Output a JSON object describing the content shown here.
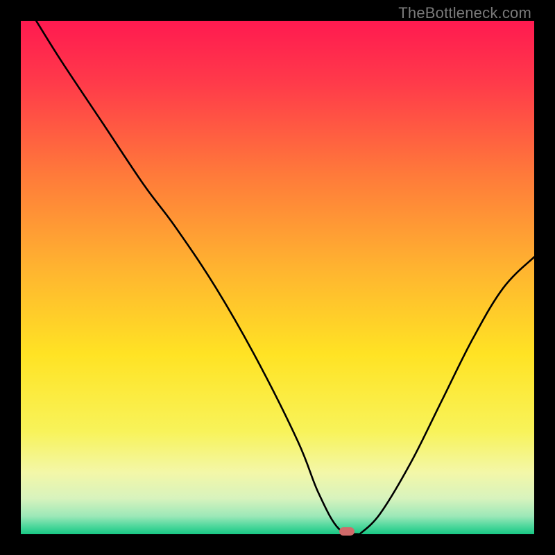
{
  "attribution": "TheBottleneck.com",
  "marker": {
    "x_pct": 63.5,
    "y_pct": 99.5,
    "color": "#d06a6a"
  },
  "chart_data": {
    "type": "line",
    "title": "",
    "xlabel": "",
    "ylabel": "",
    "xlim": [
      0,
      100
    ],
    "ylim": [
      0,
      100
    ],
    "background_gradient": {
      "direction": "vertical",
      "stops": [
        {
          "pos": 0.0,
          "color": "#ff1a50"
        },
        {
          "pos": 0.12,
          "color": "#ff3a4a"
        },
        {
          "pos": 0.3,
          "color": "#ff7a3a"
        },
        {
          "pos": 0.48,
          "color": "#ffb330"
        },
        {
          "pos": 0.65,
          "color": "#ffe324"
        },
        {
          "pos": 0.8,
          "color": "#f8f35a"
        },
        {
          "pos": 0.88,
          "color": "#f3f7a8"
        },
        {
          "pos": 0.93,
          "color": "#d8f3bd"
        },
        {
          "pos": 0.965,
          "color": "#9ce8b8"
        },
        {
          "pos": 0.985,
          "color": "#4cd79b"
        },
        {
          "pos": 1.0,
          "color": "#18c884"
        }
      ]
    },
    "series": [
      {
        "name": "left-segment",
        "x": [
          3,
          8,
          16,
          24,
          30,
          38,
          46,
          54,
          58,
          62,
          66
        ],
        "y": [
          100,
          92,
          80,
          68,
          60,
          48,
          34,
          18,
          8,
          1,
          0
        ]
      },
      {
        "name": "right-segment",
        "x": [
          66,
          70,
          76,
          82,
          88,
          94,
          100
        ],
        "y": [
          0,
          4,
          14,
          26,
          38,
          48,
          54
        ]
      }
    ],
    "marker_point": {
      "x": 63.5,
      "y": 0.5
    }
  }
}
